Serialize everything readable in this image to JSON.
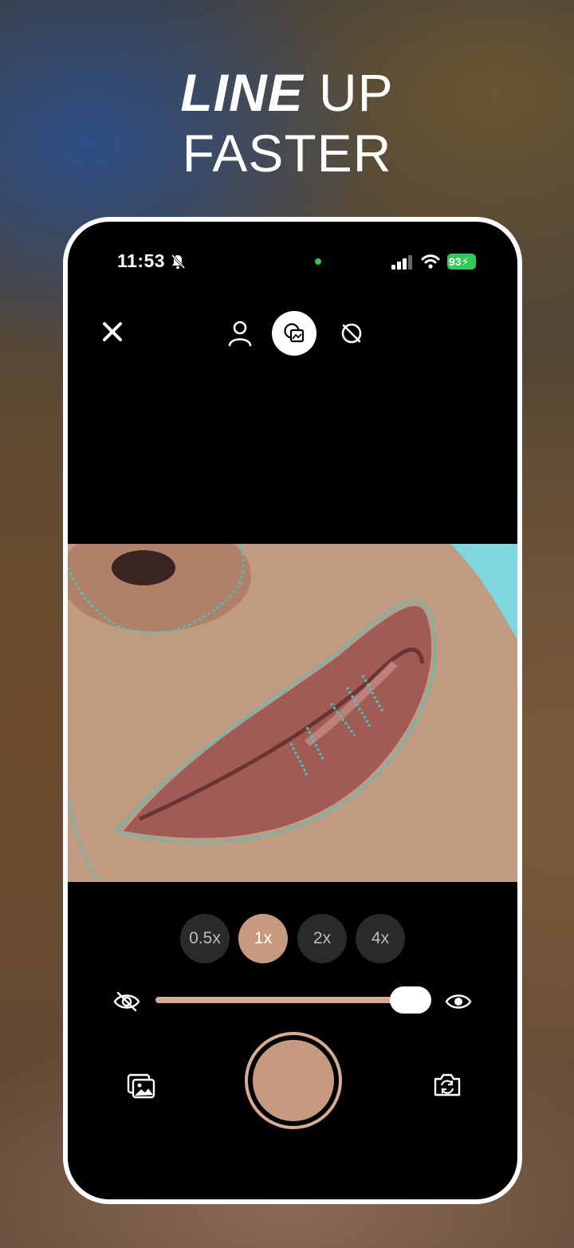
{
  "headline": {
    "line1_emphasis": "LINE",
    "line1_rest": " UP",
    "line2": "FASTER"
  },
  "status_bar": {
    "time": "11:53",
    "battery": "93"
  },
  "top_bar": {
    "close_icon": "close-icon",
    "modes": [
      "person-icon",
      "overlay-compare-icon",
      "overlay-off-icon"
    ],
    "active_mode": "overlay-compare-icon"
  },
  "zoom": {
    "options": [
      "0.5x",
      "1x",
      "2x",
      "4x"
    ],
    "selected": "1x"
  },
  "opacity_slider": {
    "value": 1.0,
    "min_icon": "eye-off-icon",
    "max_icon": "eye-icon"
  },
  "controls": {
    "gallery_icon": "gallery-icon",
    "shutter_icon": "shutter-button",
    "flip_icon": "camera-flip-icon"
  },
  "colors": {
    "accent": "#c79a7f",
    "overlay_outline": "#3ec9c6",
    "battery": "#34c759"
  }
}
